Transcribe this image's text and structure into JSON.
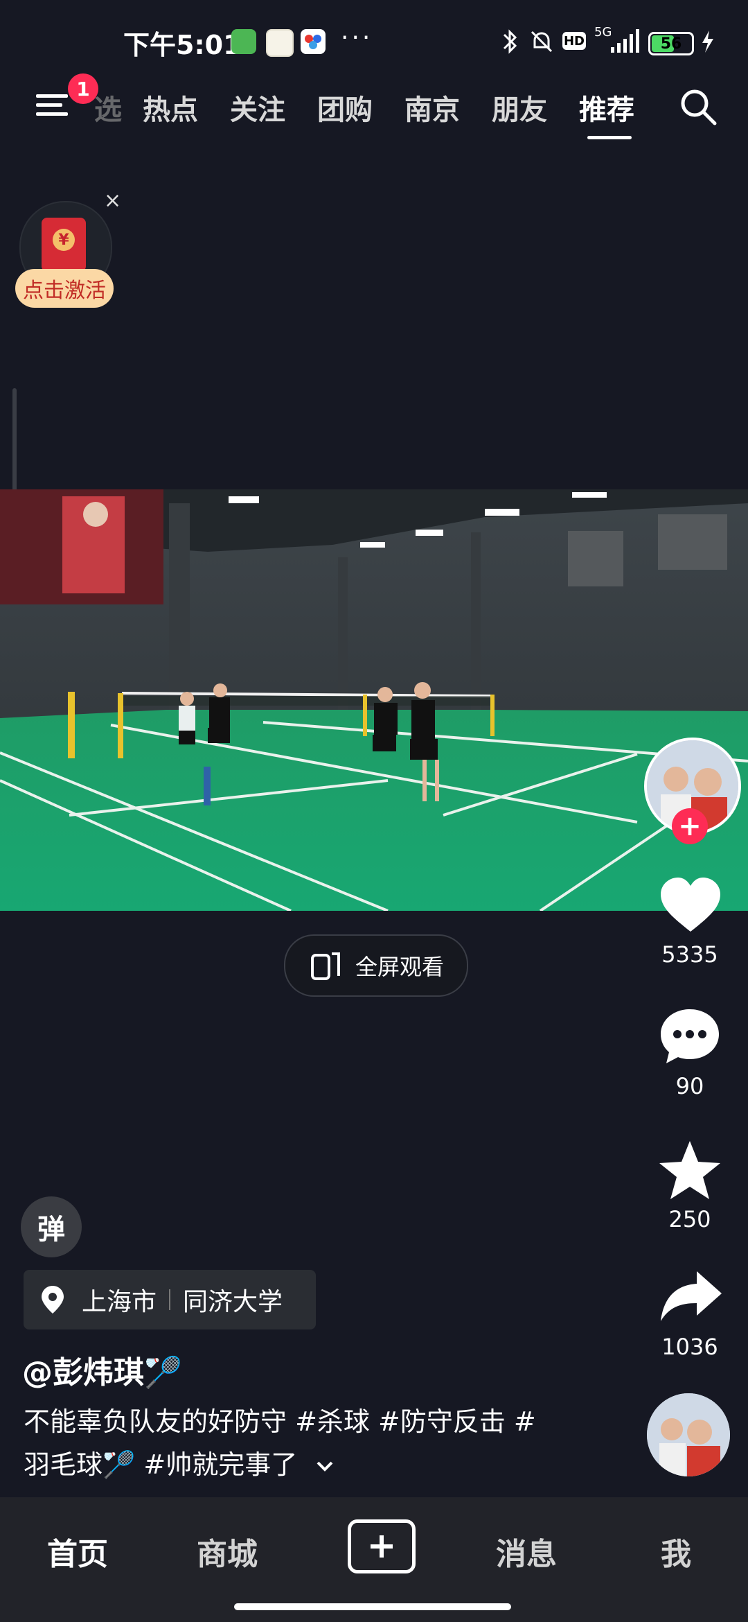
{
  "status_bar": {
    "time": "下午5:01",
    "dots": "···",
    "signal": "5G",
    "battery": "56",
    "hd": "HD",
    "app_icons": [
      "wechat-icon",
      "58-icon",
      "baidu-icon"
    ]
  },
  "top_nav": {
    "badge": "1",
    "partial_tab": "选",
    "tabs": [
      "热点",
      "关注",
      "团购",
      "南京",
      "朋友",
      "推荐"
    ],
    "active_index": 5
  },
  "red_packet": {
    "label": "点击激活",
    "yen": "¥",
    "close": "×"
  },
  "video": {
    "fullscreen_label": "全屏观看"
  },
  "actions": {
    "likes": "5335",
    "comments": "90",
    "favorites": "250",
    "shares": "1036",
    "follow_plus": "+"
  },
  "post": {
    "danmu": "弹",
    "location_city": "上海市",
    "location_place": "同济大学",
    "author": "@彭炜琪🏸",
    "caption_line1": "不能辜负队友的好防守 #杀球 #防守反击 #",
    "caption_line2": "羽毛球🏸 #帅就完事了"
  },
  "bottom_tabs": [
    "首页",
    "商城",
    "消息",
    "我"
  ],
  "colors": {
    "accent": "#fe2c55",
    "court": "#23a76b",
    "background": "#161823"
  }
}
